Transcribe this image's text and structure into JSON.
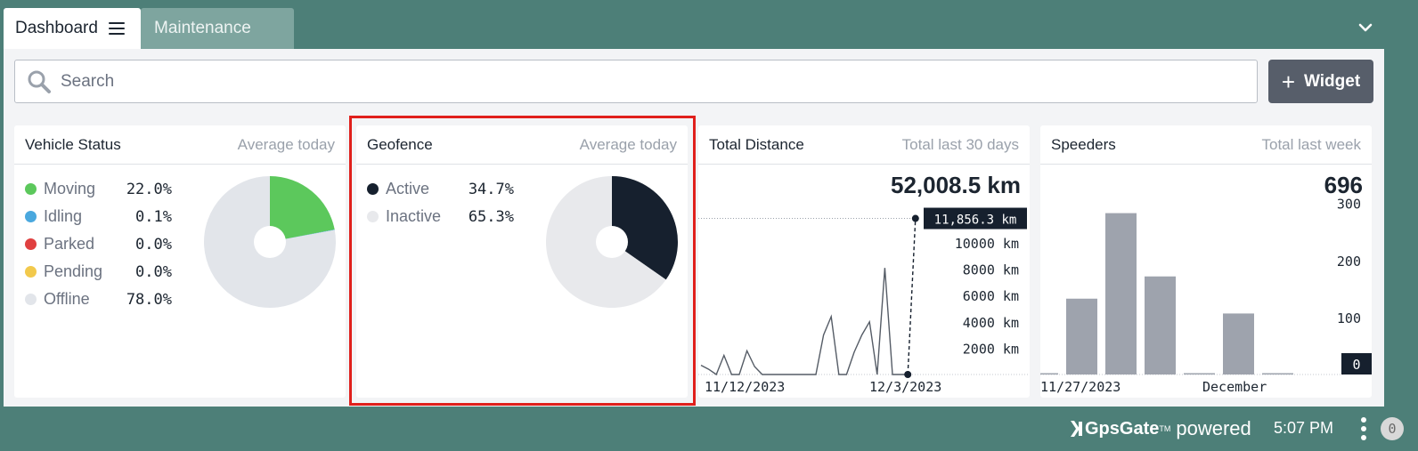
{
  "tabs": {
    "dashboard": "Dashboard",
    "maintenance": "Maintenance"
  },
  "search": {
    "placeholder": "Search"
  },
  "widget_button": {
    "label": "Widget"
  },
  "cards": {
    "vehicle_status": {
      "title": "Vehicle Status",
      "subtitle": "Average today",
      "items": [
        {
          "label": "Moving",
          "value": "22.0%",
          "color": "#5cc85c",
          "pct": 22.0
        },
        {
          "label": "Idling",
          "value": "0.1%",
          "color": "#4aa8de",
          "pct": 0.1
        },
        {
          "label": "Parked",
          "value": "0.0%",
          "color": "#e04040",
          "pct": 0.0
        },
        {
          "label": "Pending",
          "value": "0.0%",
          "color": "#f2c94c",
          "pct": 0.0
        },
        {
          "label": "Offline",
          "value": "78.0%",
          "color": "#e2e5ea",
          "pct": 78.0
        }
      ]
    },
    "geofence": {
      "title": "Geofence",
      "subtitle": "Average today",
      "items": [
        {
          "label": "Active",
          "value": "34.7%",
          "color": "#16202e",
          "pct": 34.7
        },
        {
          "label": "Inactive",
          "value": "65.3%",
          "color": "#e8e9ec",
          "pct": 65.3
        }
      ]
    },
    "total_distance": {
      "title": "Total Distance",
      "subtitle": "Total last 30 days",
      "total": "52,008.5 km",
      "callout": "11,856.3 km"
    },
    "speeders": {
      "title": "Speeders",
      "subtitle": "Total last week",
      "total": "696"
    }
  },
  "chart_data": [
    {
      "type": "pie",
      "title": "Vehicle Status",
      "categories": [
        "Moving",
        "Idling",
        "Parked",
        "Pending",
        "Offline"
      ],
      "values": [
        22.0,
        0.1,
        0.0,
        0.0,
        78.0
      ]
    },
    {
      "type": "pie",
      "title": "Geofence",
      "categories": [
        "Active",
        "Inactive"
      ],
      "values": [
        34.7,
        65.3
      ]
    },
    {
      "type": "line",
      "title": "Total Distance",
      "x_ticks": [
        "11/12/2023",
        "12/3/2023"
      ],
      "y_ticks": [
        "2000 km",
        "4000 km",
        "6000 km",
        "8000 km",
        "10000 km"
      ],
      "ylim": [
        0,
        12500
      ],
      "values": [
        700,
        400,
        0,
        1450,
        0,
        0,
        1800,
        600,
        0,
        0,
        0,
        0,
        0,
        0,
        0,
        0,
        3000,
        4400,
        0,
        0,
        1700,
        3000,
        4000,
        0,
        8100,
        0,
        0,
        0,
        11856.3
      ],
      "highlight": {
        "index": 28,
        "label": "11,856.3 km"
      }
    },
    {
      "type": "bar",
      "title": "Speeders",
      "x_ticks": [
        "11/27/2023",
        "December"
      ],
      "y_ticks": [
        "100",
        "200",
        "300"
      ],
      "ylim": [
        0,
        310
      ],
      "values": [
        1,
        133,
        283,
        172,
        1,
        107,
        1,
        0
      ],
      "last_label": "0"
    }
  ],
  "footer": {
    "brand": "GpsGate",
    "trademark": "TM",
    "powered": "powered",
    "time": "5:07 PM",
    "notifications": "0"
  },
  "colors": {
    "background": "#4d7f78",
    "highlight": "#e0201c",
    "dark": "#16202e",
    "bar": "#9ea3ad"
  }
}
